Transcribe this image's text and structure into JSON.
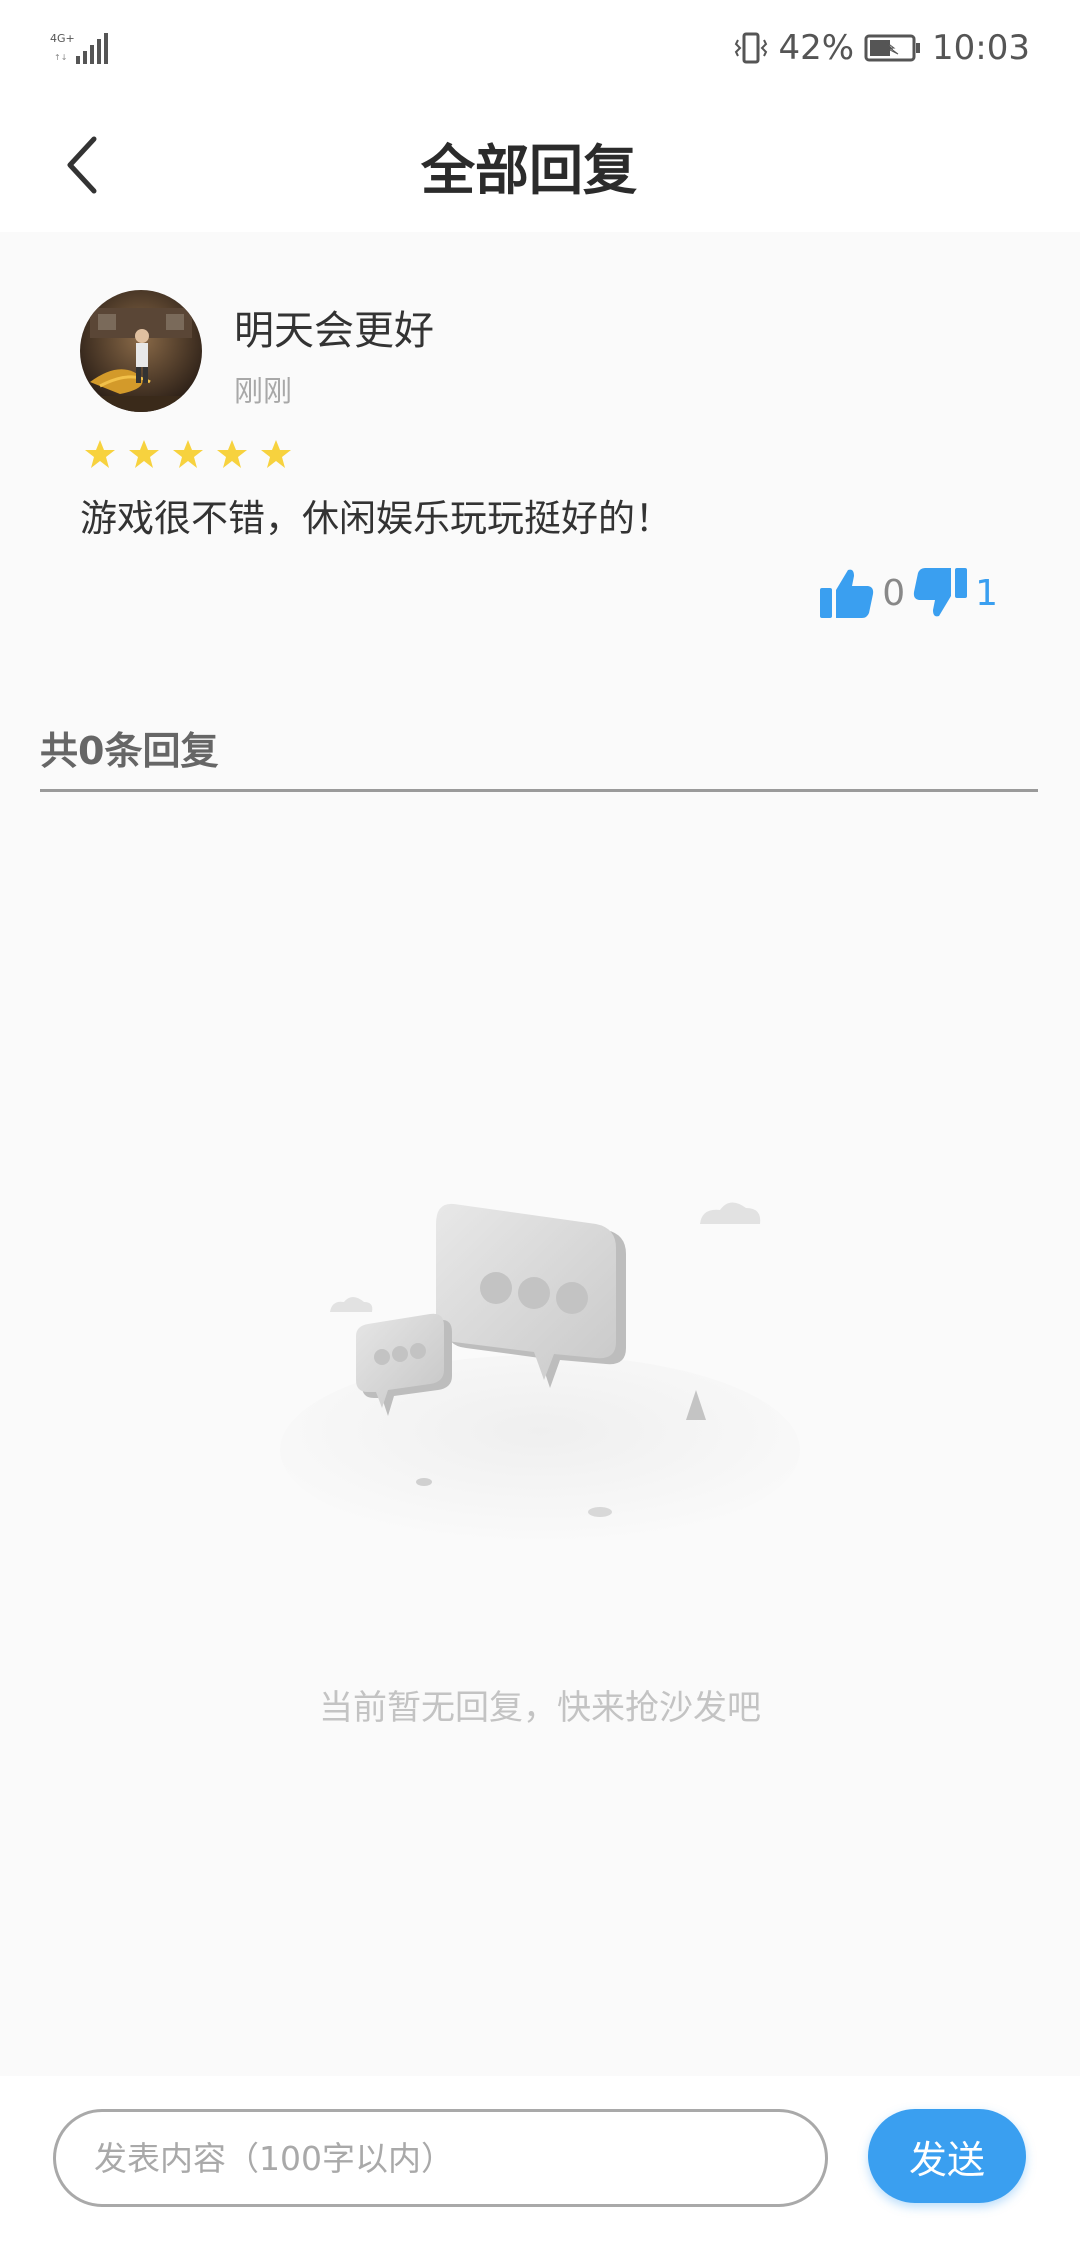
{
  "status_bar": {
    "network": "4G+",
    "battery_percent": "42%",
    "time": "10:03"
  },
  "header": {
    "title": "全部回复",
    "back_icon": "chevron-left-icon"
  },
  "comment": {
    "username": "明天会更好",
    "time": "刚刚",
    "rating": 5,
    "text": "游戏很不错，休闲娱乐玩玩挺好的！",
    "likes": "0",
    "dislikes": "1"
  },
  "replies": {
    "header": "共0条回复",
    "empty_text": "当前暂无回复，快来抢沙发吧"
  },
  "input": {
    "placeholder": "发表内容（100字以内）",
    "send_label": "发送"
  },
  "colors": {
    "accent": "#3a9ff0",
    "star": "#f7d23e",
    "background": "#fafafa"
  }
}
